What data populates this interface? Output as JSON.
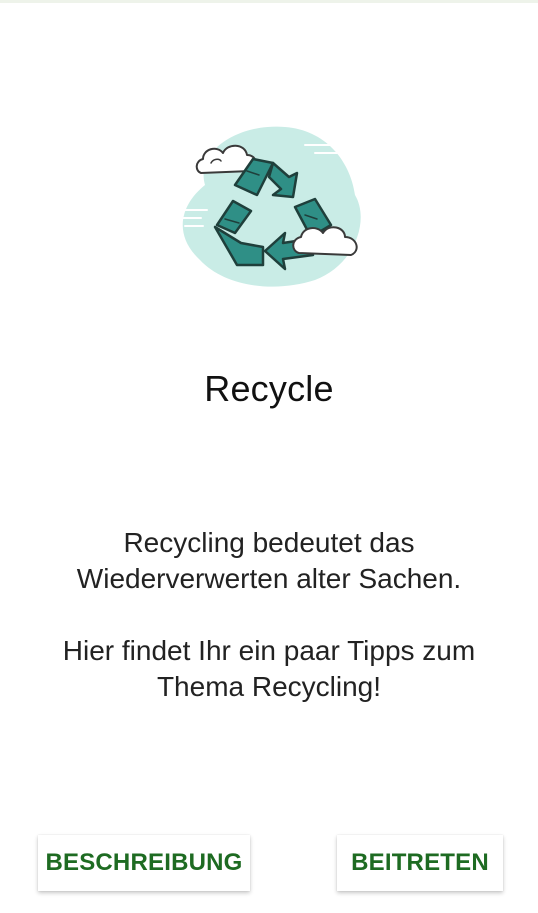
{
  "screen": {
    "title": "Recycle",
    "description_line1": "Recycling bedeutet das Wiederverwerten alter Sachen.",
    "description_line2": "Hier findet Ihr ein paar Tipps zum Thema Recycling!",
    "illustration_icon": "recycle-clouds-icon"
  },
  "actions": {
    "left_label": "BESCHREIBUNG",
    "right_label": "BEITRETEN"
  },
  "colors": {
    "accent_green": "#1e6b22",
    "teal": "#2f8f86",
    "cloud_bg": "#c9ece6"
  }
}
